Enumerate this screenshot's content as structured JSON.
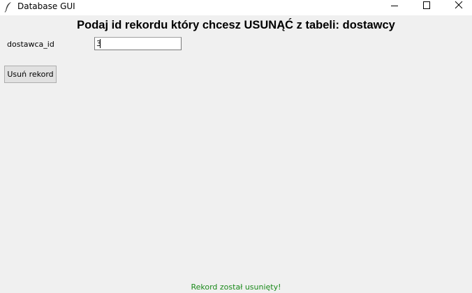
{
  "window": {
    "title": "Database GUI",
    "icon": "feather-icon",
    "controls": [
      "minimize-icon",
      "maximize-icon",
      "close-icon"
    ]
  },
  "form": {
    "heading": "Podaj id rekordu który chcesz USUNĄĆ z tabeli: dostawcy",
    "field_label": "dostawca_id",
    "field_value": "3",
    "button_label": "Usuń rekord"
  },
  "status": {
    "message": "Rekord został usunięty!",
    "color": "#1a8a1a"
  }
}
